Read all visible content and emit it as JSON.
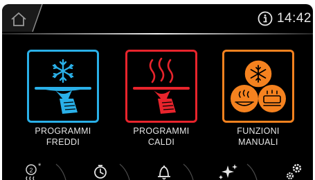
{
  "status_bar": {
    "info_icon": "info-circle-icon",
    "time": "14:42",
    "home_icon": "home-icon"
  },
  "tiles": [
    {
      "id": "cold",
      "label_line1": "PROGRAMMI",
      "label_line2": "FREDDI",
      "icon": "snowflake-serving-tray-icon",
      "color": "#2ab0e8"
    },
    {
      "id": "hot",
      "label_line1": "PROGRAMMI",
      "label_line2": "CALDI",
      "icon": "steam-serving-tray-icon",
      "color": "#e8242c"
    },
    {
      "id": "manual",
      "label_line1": "FUNZIONI",
      "label_line2": "MANUALI",
      "icon": "snowflake-hot-food-icon",
      "color": "#f5821f"
    }
  ],
  "bottom_nav": [
    {
      "id": "recipes",
      "icon": "numbered-program-icon"
    },
    {
      "id": "timer",
      "icon": "timer-icon"
    },
    {
      "id": "alarms",
      "icon": "bell-icon"
    },
    {
      "id": "cleaning",
      "icon": "sparkle-icon"
    },
    {
      "id": "settings",
      "icon": "gears-icon"
    }
  ],
  "colors": {
    "background": "#000000",
    "text": "#e6e6e6",
    "cold": "#2ab0e8",
    "hot": "#e8242c",
    "manual": "#f5821f"
  }
}
